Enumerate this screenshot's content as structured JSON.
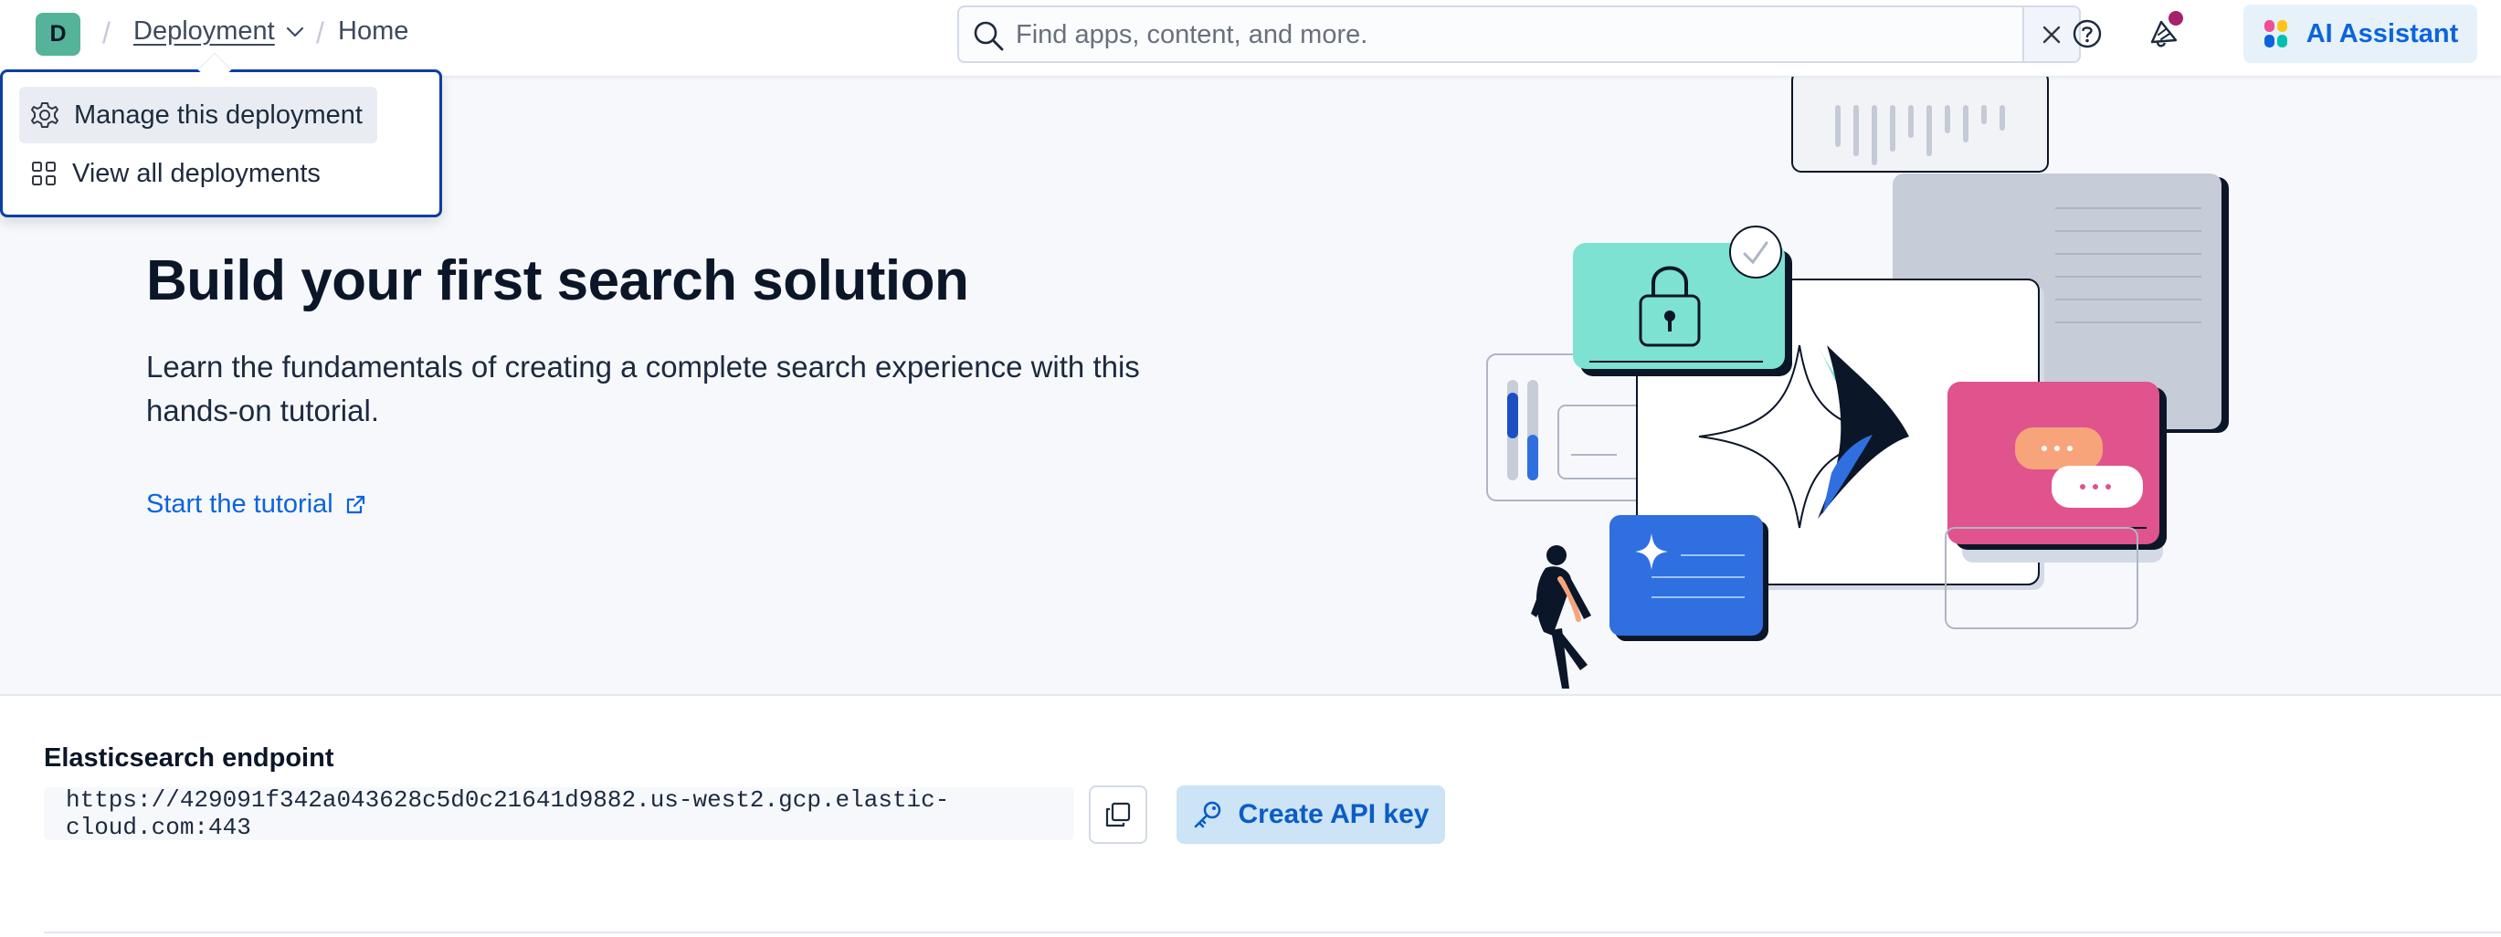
{
  "header": {
    "avatar_letter": "D",
    "breadcrumbs": {
      "separator": "/",
      "deployment": "Deployment",
      "home": "Home"
    },
    "search": {
      "placeholder": "Find apps, content, and more."
    },
    "ai_assistant_label": "AI Assistant"
  },
  "deployment_menu": {
    "items": [
      {
        "label": "Manage this deployment",
        "icon": "gear-icon",
        "active": true
      },
      {
        "label": "View all deployments",
        "icon": "grid-icon",
        "active": false
      }
    ]
  },
  "hero": {
    "title": "Build your first search solution",
    "description": "Learn the fundamentals of creating a complete search experience with this hands-on tutorial.",
    "link_label": "Start the tutorial"
  },
  "endpoint": {
    "label": "Elasticsearch endpoint",
    "url": "https://429091f342a043628c5d0c21641d9882.us-west2.gcp.elastic-cloud.com:443",
    "create_api_key_label": "Create API key"
  },
  "colors": {
    "accent": "#0b64dd",
    "avatar": "#54b399",
    "notification_dot": "#a6226b",
    "dropdown_border": "#0b3fa3"
  }
}
